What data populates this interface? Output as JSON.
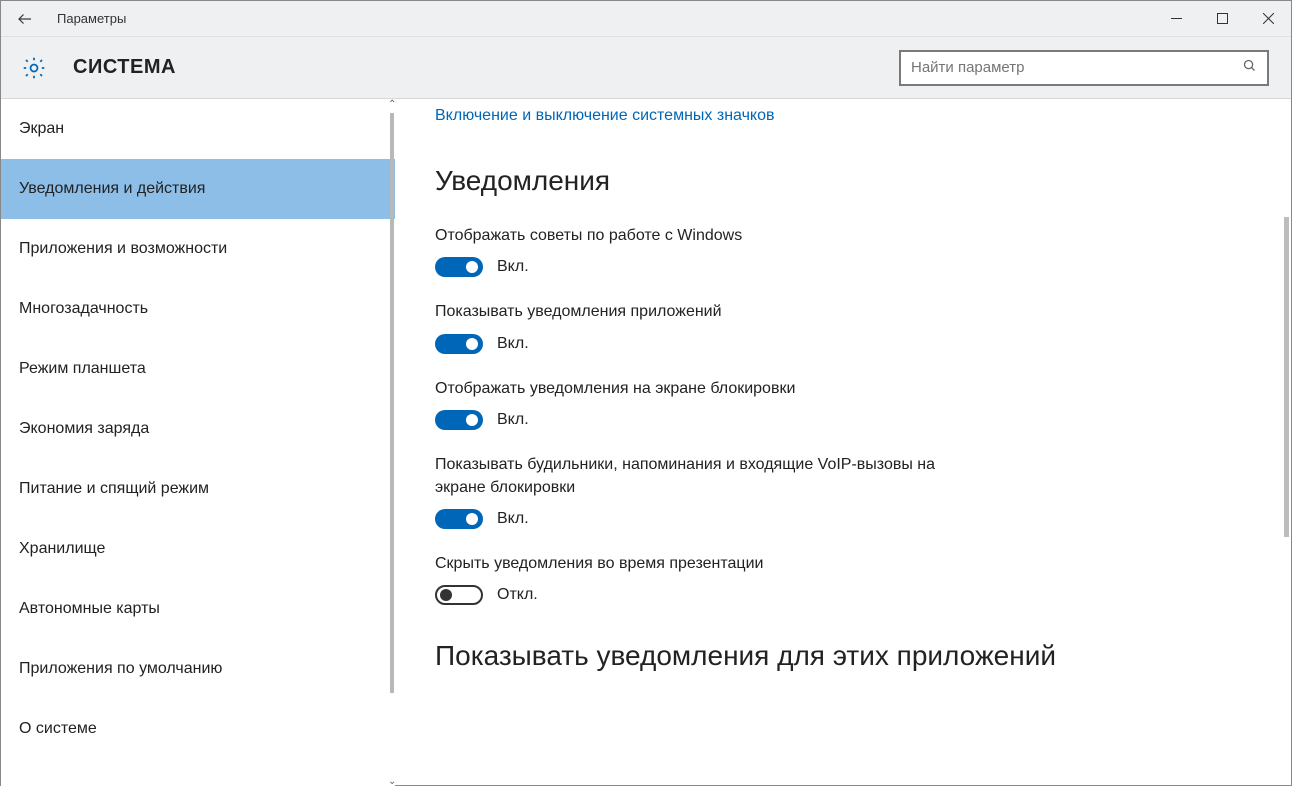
{
  "window": {
    "title": "Параметры"
  },
  "header": {
    "system_title": "СИСТЕМА",
    "search_placeholder": "Найти параметр"
  },
  "sidebar": {
    "items": [
      {
        "label": "Экран",
        "active": false
      },
      {
        "label": "Уведомления и действия",
        "active": true
      },
      {
        "label": "Приложения и возможности",
        "active": false
      },
      {
        "label": "Многозадачность",
        "active": false
      },
      {
        "label": "Режим планшета",
        "active": false
      },
      {
        "label": "Экономия заряда",
        "active": false
      },
      {
        "label": "Питание и спящий режим",
        "active": false
      },
      {
        "label": "Хранилище",
        "active": false
      },
      {
        "label": "Автономные карты",
        "active": false
      },
      {
        "label": "Приложения по умолчанию",
        "active": false
      },
      {
        "label": "О системе",
        "active": false
      }
    ]
  },
  "content": {
    "link_system_icons": "Включение и выключение системных значков",
    "section_notifications": "Уведомления",
    "state_on": "Вкл.",
    "state_off": "Откл.",
    "settings": [
      {
        "label": "Отображать советы по работе с Windows",
        "on": true
      },
      {
        "label": "Показывать уведомления приложений",
        "on": true
      },
      {
        "label": "Отображать уведомления на экране блокировки",
        "on": true
      },
      {
        "label": "Показывать будильники, напоминания и входящие VoIP-вызовы на экране блокировки",
        "on": true
      },
      {
        "label": "Скрыть уведомления во время презентации",
        "on": false
      }
    ],
    "section_apps": "Показывать уведомления для этих приложений"
  }
}
